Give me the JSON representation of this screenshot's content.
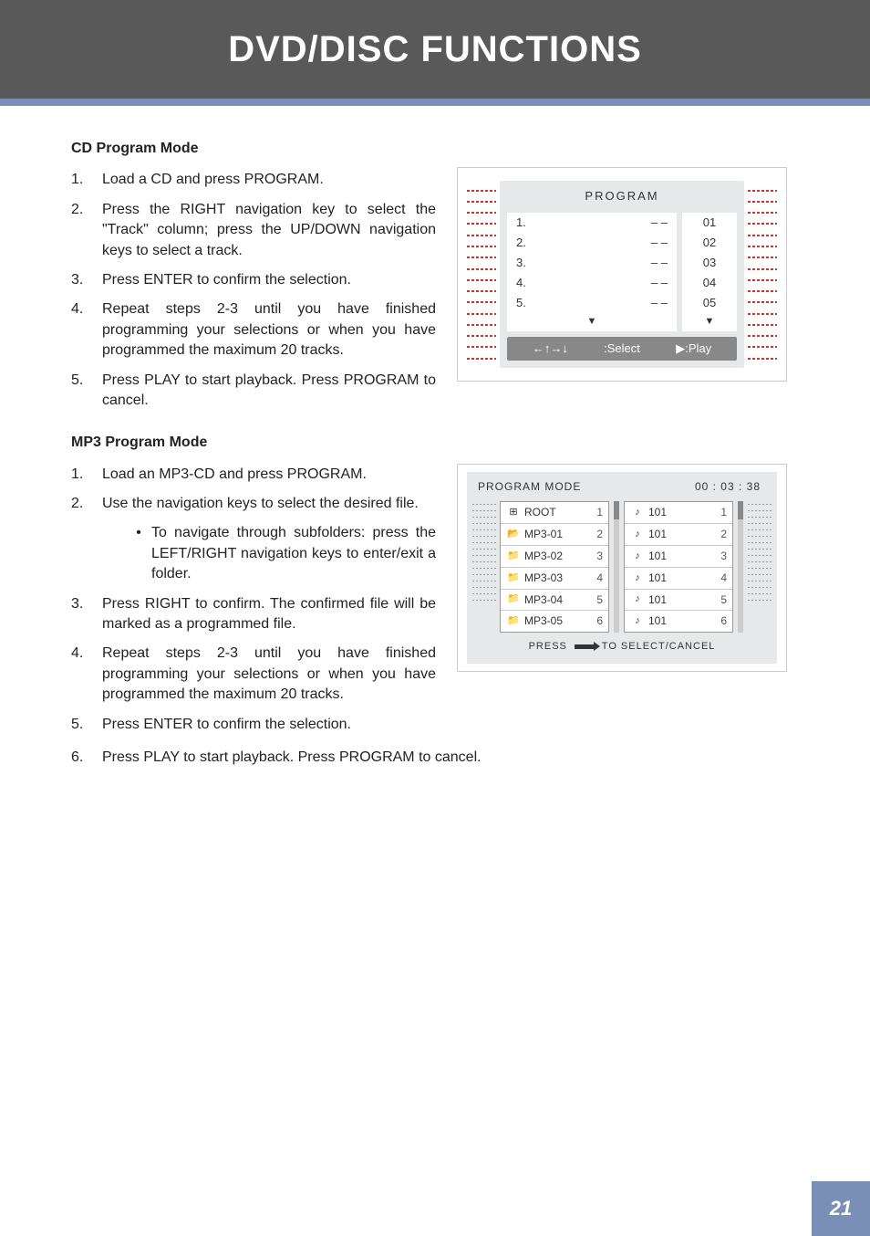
{
  "header": {
    "title": "DVD/DISC FUNCTIONS"
  },
  "page_number": "21",
  "cd": {
    "title": "CD Program Mode",
    "steps": [
      "Load a CD and press PROGRAM.",
      "Press the RIGHT navigation key to select the \"Track\" column; press the UP/DOWN navigation keys to select a track.",
      "Press ENTER to confirm the selection.",
      "Repeat steps 2-3 until you have finished programming your selections or when you have programmed the maximum 20 tracks.",
      "Press PLAY to start playback. Press PROGRAM to cancel."
    ]
  },
  "mp3": {
    "title": "MP3 Program Mode",
    "steps": [
      "Load an MP3-CD and press PROGRAM.",
      "Use the navigation keys to select the desired file.",
      "Press RIGHT to confirm. The confirmed file will be marked as a programmed file.",
      "Repeat steps 2-3 until you have finished programming your selections or when you have programmed the maximum 20 tracks.",
      "Press ENTER to confirm the selection.",
      "Press PLAY to start playback. Press PROGRAM to cancel."
    ],
    "substep": "To navigate through subfolders: press the LEFT/RIGHT navigation keys to enter/exit a folder."
  },
  "fig1": {
    "title": "PROGRAM",
    "left_rows": [
      {
        "n": "1.",
        "v": "– –"
      },
      {
        "n": "2.",
        "v": "– –"
      },
      {
        "n": "3.",
        "v": "– –"
      },
      {
        "n": "4.",
        "v": "– –"
      },
      {
        "n": "5.",
        "v": "– –"
      }
    ],
    "right_rows": [
      "01",
      "02",
      "03",
      "04",
      "05"
    ],
    "nav_arrows": "←↑→↓",
    "select_label": ":Select",
    "play_label": "▶:Play"
  },
  "fig2": {
    "title": "PROGRAM MODE",
    "time": "00 : 03 : 38",
    "folders": [
      {
        "icon": "⊞",
        "name": "ROOT",
        "n": "1"
      },
      {
        "icon": "📂",
        "name": "MP3-01",
        "n": "2"
      },
      {
        "icon": "📁",
        "name": "MP3-02",
        "n": "3"
      },
      {
        "icon": "📁",
        "name": "MP3-03",
        "n": "4"
      },
      {
        "icon": "📁",
        "name": "MP3-04",
        "n": "5"
      },
      {
        "icon": "📁",
        "name": "MP3-05",
        "n": "6"
      }
    ],
    "tracks": [
      {
        "t": "101",
        "n": "1"
      },
      {
        "t": "101",
        "n": "2"
      },
      {
        "t": "101",
        "n": "3"
      },
      {
        "t": "101",
        "n": "4"
      },
      {
        "t": "101",
        "n": "5"
      },
      {
        "t": "101",
        "n": "6"
      }
    ],
    "footer_pre": "PRESS",
    "footer_post": "TO SELECT/CANCEL"
  }
}
